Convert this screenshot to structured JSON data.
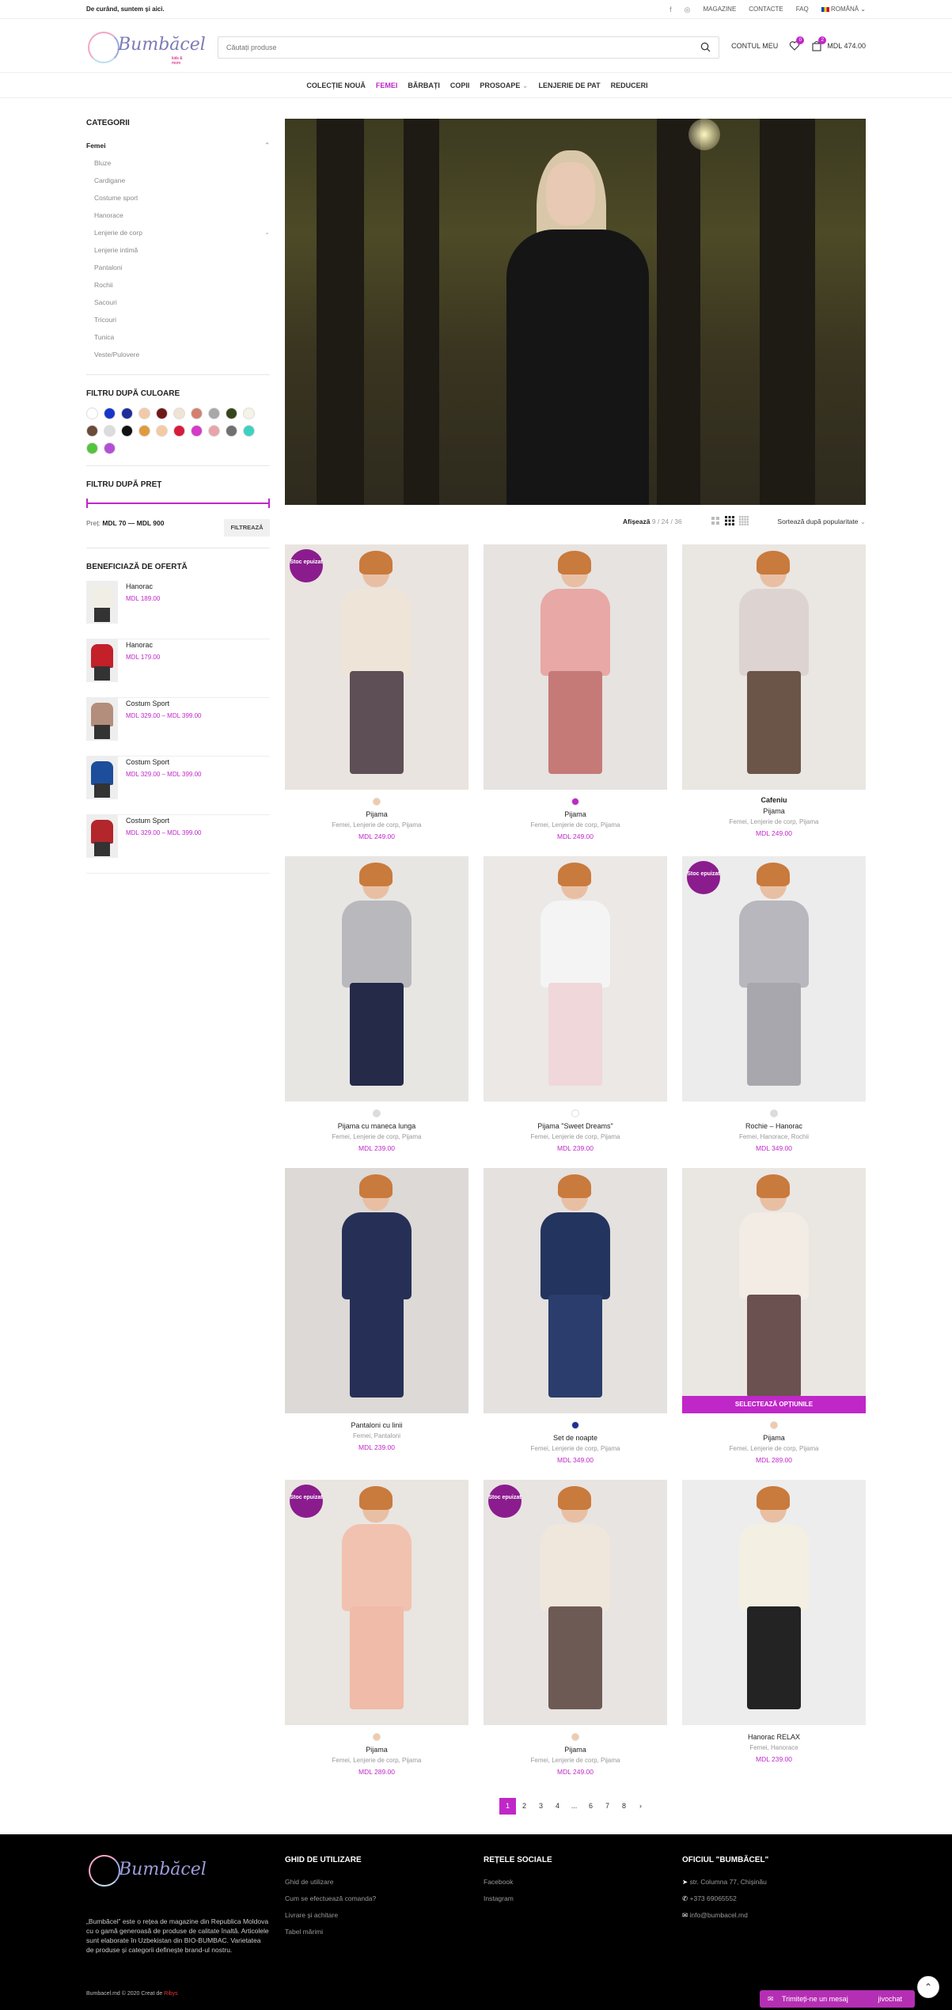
{
  "topbar": {
    "message": "De curând, suntem și aici.",
    "links": [
      "MAGAZINE",
      "CONTACTE",
      "FAQ"
    ],
    "language": "ROMÂNĂ"
  },
  "header": {
    "logo_text": "Bumbăcel",
    "logo_sub": "kids & mom",
    "search_placeholder": "Căutați produse",
    "account": "CONTUL MEU",
    "wishlist_count": "0",
    "cart_count": "2",
    "cart_total": "MDL 474.00"
  },
  "nav": [
    "COLECȚIE NOUĂ",
    "FEMEI",
    "BĂRBAȚI",
    "COPII",
    "PROSOAPE",
    "LENJERIE DE PAT",
    "REDUCERI"
  ],
  "sidebar": {
    "categories_title": "CATEGORII",
    "categories": [
      {
        "label": "Femei",
        "top": true
      },
      {
        "label": "Bluze"
      },
      {
        "label": "Cardigane"
      },
      {
        "label": "Costume sport"
      },
      {
        "label": "Hanorace"
      },
      {
        "label": "Lenjerie de corp",
        "expand": true
      },
      {
        "label": "Lenjerie intimă"
      },
      {
        "label": "Pantaloni"
      },
      {
        "label": "Rochii"
      },
      {
        "label": "Sacouri"
      },
      {
        "label": "Tricouri"
      },
      {
        "label": "Tunica"
      },
      {
        "label": "Veste/Pulovere"
      }
    ],
    "color_filter_title": "FILTRU DUPĂ CULOARE",
    "colors": [
      "#ffffff",
      "#1636c9",
      "#1e2f9a",
      "#f2c9a8",
      "#6e1a1a",
      "#efe3d3",
      "#d4806e",
      "#a8a8a8",
      "#35461a",
      "#f5f2e6",
      "#6b4a3a",
      "#dcdcdc",
      "#111111",
      "#e09a3c",
      "#f5c9a2",
      "#d81b3c",
      "#d63ac8",
      "#e8a5a8",
      "#707070",
      "#3ed1c1",
      "#54c43c",
      "#b34fd6"
    ],
    "price_filter_title": "FILTRU DUPĂ PREȚ",
    "price_label": "Preț:",
    "price_range": "MDL 70 — MDL 900",
    "filter_button": "FILTREAZĂ",
    "offers_title": "BENEFICIAZĂ DE OFERTĂ",
    "offers": [
      {
        "name": "Hanorac",
        "price": "MDL 189.00",
        "color": "#f1eee6"
      },
      {
        "name": "Hanorac",
        "price": "MDL 179.00",
        "color": "#c3202a"
      },
      {
        "name": "Costum Sport",
        "price": "MDL 329.00 – MDL 399.00",
        "color": "#b48e7c"
      },
      {
        "name": "Costum Sport",
        "price": "MDL 329.00 – MDL 399.00",
        "color": "#1d4e9c"
      },
      {
        "name": "Costum Sport",
        "price": "MDL 329.00 – MDL 399.00",
        "color": "#b3262c"
      }
    ]
  },
  "toolbar": {
    "show_label": "Afișează",
    "show_options": "9 / 24 / 36",
    "sort": "Sortează după popularitate"
  },
  "products": [
    {
      "name": "Pijama",
      "cats": "Femei, Lenjerie de corp, Pijama",
      "price": "MDL 249.00",
      "badge": "Stoc epuizat",
      "dot": "#f2c9a8",
      "bg": "#e9e4df",
      "top": "#efe4d8",
      "bottom": "#5e4e55"
    },
    {
      "name": "Pijama",
      "cats": "Femei, Lenjerie de corp, Pijama",
      "price": "MDL 249.00",
      "badge": "",
      "dot": "#c027c9",
      "bg": "#e7e3e0",
      "top": "#e8a8a6",
      "bottom": "#c57a78"
    },
    {
      "name": "Pijama",
      "cats": "Femei, Lenjerie de corp, Pijama",
      "price": "MDL 249.00",
      "badge": "",
      "dot": "",
      "color_label": "Cafeniu",
      "bg": "#eae6e2",
      "top": "#ddd4d2",
      "bottom": "#6b5548"
    },
    {
      "name": "Pijama cu maneca lunga",
      "cats": "Femei, Lenjerie de corp, Pijama",
      "price": "MDL 239.00",
      "badge": "",
      "dot": "#dcdcdc",
      "bg": "#e8e6e3",
      "top": "#b9b9bd",
      "bottom": "#242a48"
    },
    {
      "name": "Pijama \"Sweet Dreams\"",
      "cats": "Femei, Lenjerie de corp, Pijama",
      "price": "MDL 239.00",
      "badge": "",
      "dot": "#ffffff",
      "bg": "#ebe8e6",
      "top": "#f4f4f4",
      "bottom": "#f0d7d9"
    },
    {
      "name": "Rochie – Hanorac",
      "cats": "Femei, Hanorace, Rochii",
      "price": "MDL 349.00",
      "badge": "Stoc epuizat",
      "dot": "#dcdcdc",
      "bg": "#ececec",
      "top": "#b7b7bd",
      "bottom": "#a7a7ad"
    },
    {
      "name": "Pantaloni cu linii",
      "cats": "Femei, Pantaloni",
      "price": "MDL 239.00",
      "badge": "",
      "dot": "",
      "bg": "#dcd9d6",
      "top": "#263057",
      "bottom": "#263057"
    },
    {
      "name": "Set de noapte",
      "cats": "Femei, Lenjerie de corp, Pijama",
      "price": "MDL 349.00",
      "badge": "",
      "dot": "#1e2f9a",
      "bg": "#e4e1de",
      "top": "#23345e",
      "bottom": "#2b3d6c"
    },
    {
      "name": "Pijama",
      "cats": "Femei, Lenjerie de corp, Pijama",
      "price": "MDL 289.00",
      "badge": "",
      "dot": "#f2c9a8",
      "select": "SELECTEAZĂ OPȚIUNILE",
      "bg": "#eae6e2",
      "top": "#f2ece4",
      "bottom": "#6b5150"
    },
    {
      "name": "Pijama",
      "cats": "Femei, Lenjerie de corp, Pijama",
      "price": "MDL 289.00",
      "badge": "Stoc epuizat",
      "dot": "#f2c9a8",
      "bg": "#e9e5e1",
      "top": "#f2c2b0",
      "bottom": "#f0bba8"
    },
    {
      "name": "Pijama",
      "cats": "Femei, Lenjerie de corp, Pijama",
      "price": "MDL 249.00",
      "badge": "Stoc epuizat",
      "dot": "#f2c9a8",
      "bg": "#e8e4e1",
      "top": "#efe7dc",
      "bottom": "#6e5a55"
    },
    {
      "name": "Hanorac RELAX",
      "cats": "Femei, Hanorace",
      "price": "MDL 239.00",
      "badge": "",
      "dot": "",
      "bg": "#ededed",
      "top": "#f4efe3",
      "bottom": "#232323"
    }
  ],
  "pagination": [
    "1",
    "2",
    "3",
    "4",
    "...",
    "6",
    "7",
    "8",
    "›"
  ],
  "footer": {
    "about": "„Bumbăcel” este o rețea de magazine din Republica Moldova cu o gamă generoasă de produse de calitate înaltă. Articolele sunt elaborate în Uzbekistan din BIO-BUMBAC. Varietatea de produse și categorii definește brand-ul nostru.",
    "guide_title": "GHID DE UTILIZARE",
    "guide": [
      "Ghid de utilizare",
      "Cum se efectuează comanda?",
      "Livrare și achitare",
      "Tabel mărimi"
    ],
    "social_title": "REȚELE SOCIALE",
    "social": [
      "Facebook",
      "Instagram"
    ],
    "official_title": "OFICIUL \"BUMBĂCEL\"",
    "official": [
      "str. Columna 77, Chișinău",
      "+373 69065552",
      "info@bumbacel.md"
    ],
    "copyright": "Bumbacel.md © 2020 Creat de",
    "copyright_link": "Ribys"
  },
  "chat": {
    "label": "Trimiteți-ne un mesaj",
    "brand": "jivochat"
  }
}
